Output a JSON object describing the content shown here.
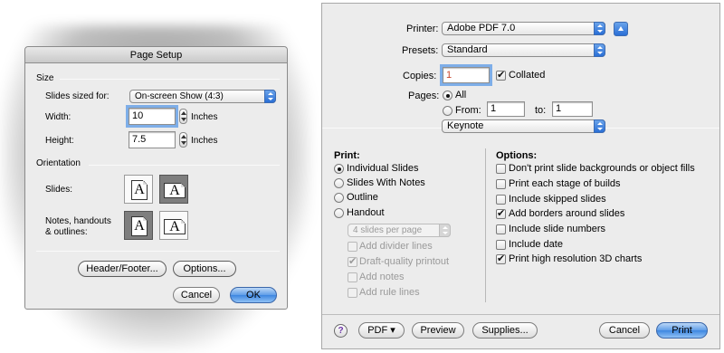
{
  "page_setup": {
    "title": "Page Setup",
    "size_group": "Size",
    "slides_sized_for_label": "Slides sized for:",
    "slides_sized_for_value": "On-screen Show (4:3)",
    "width_label": "Width:",
    "width_value": "10",
    "width_unit": "Inches",
    "height_label": "Height:",
    "height_value": "7.5",
    "height_unit": "Inches",
    "orientation_group": "Orientation",
    "slides_label": "Slides:",
    "notes_label": "Notes, handouts & outlines:",
    "slides_orientation_selected": "landscape",
    "notes_orientation_selected": "portrait",
    "page_glyph": "A",
    "header_footer_button": "Header/Footer...",
    "options_button": "Options...",
    "cancel_button": "Cancel",
    "ok_button": "OK"
  },
  "print": {
    "printer_label": "Printer:",
    "printer_value": "Adobe PDF 7.0",
    "presets_label": "Presets:",
    "presets_value": "Standard",
    "copies_label": "Copies:",
    "copies_value": "1",
    "collated_label": "Collated",
    "collated_checked": true,
    "pages_label": "Pages:",
    "pages_all_label": "All",
    "pages_from_label": "From:",
    "pages_from_value": "1",
    "pages_to_label": "to:",
    "pages_to_value": "1",
    "pages_selected": "All",
    "panel_value": "Keynote",
    "print_group_label": "Print:",
    "print_options": [
      {
        "label": "Individual Slides",
        "selected": true
      },
      {
        "label": "Slides With Notes",
        "selected": false
      },
      {
        "label": "Outline",
        "selected": false
      },
      {
        "label": "Handout",
        "selected": false
      }
    ],
    "handout_popup": "4 slides per page",
    "handout_options": [
      {
        "label": "Add divider lines",
        "checked": false
      },
      {
        "label": "Draft-quality printout",
        "checked": true
      },
      {
        "label": "Add notes",
        "checked": false
      },
      {
        "label": "Add rule lines",
        "checked": false
      }
    ],
    "options_group_label": "Options:",
    "options": [
      {
        "label": "Don't print slide backgrounds or object fills",
        "checked": false
      },
      {
        "label": "Print each stage of builds",
        "checked": false
      },
      {
        "label": "Include skipped slides",
        "checked": false
      },
      {
        "label": "Add borders around slides",
        "checked": true
      },
      {
        "label": "Include slide numbers",
        "checked": false
      },
      {
        "label": "Include date",
        "checked": false
      },
      {
        "label": "Print high resolution 3D charts",
        "checked": true
      }
    ],
    "help_glyph": "?",
    "pdf_button": "PDF ▾",
    "preview_button": "Preview",
    "supplies_button": "Supplies...",
    "cancel_button": "Cancel",
    "print_button": "Print"
  },
  "colors": {
    "window_bg": "#ececec",
    "accent_blue": "#3d86e0",
    "focus_ring": "#7eaee8",
    "disabled_text": "#9a9a9a"
  }
}
